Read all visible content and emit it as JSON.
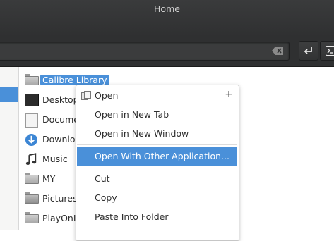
{
  "window": {
    "title": "Home"
  },
  "toolbar": {
    "location_value": ""
  },
  "files": [
    {
      "label": "Calibre Library",
      "icon": "folder-icon",
      "selected": true
    },
    {
      "label": "Desktop",
      "icon": "desktop-folder-icon"
    },
    {
      "label": "Docume",
      "icon": "documents-folder-icon"
    },
    {
      "label": "Downlo",
      "icon": "downloads-folder-icon"
    },
    {
      "label": "Music",
      "icon": "music-folder-icon"
    },
    {
      "label": "MY",
      "icon": "folder-icon"
    },
    {
      "label": "Pictures",
      "icon": "pictures-folder-icon"
    },
    {
      "label": "PlayOnLi",
      "icon": "folder-icon"
    }
  ],
  "context_menu": {
    "items": [
      {
        "label": "Open",
        "icon": "open-icon",
        "shortcut": "+"
      },
      {
        "label": "Open in New Tab"
      },
      {
        "label": "Open in New Window"
      },
      {
        "label": "Open With Other Application...",
        "highlighted": true
      },
      {
        "label": "Cut"
      },
      {
        "label": "Copy"
      },
      {
        "label": "Paste Into Folder"
      }
    ]
  },
  "colors": {
    "selection": "#4a90d9",
    "titlebar": "#2f3031"
  }
}
